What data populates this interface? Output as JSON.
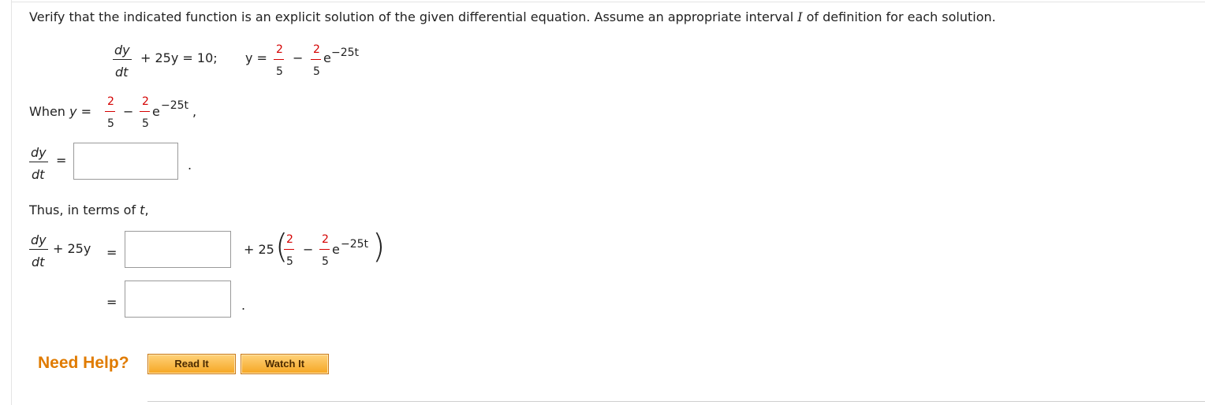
{
  "question": {
    "instructions_a": "Verify that the indicated function is an explicit solution of the given differential equation. Assume an appropriate interval ",
    "interval_symbol": "I",
    "instructions_b": " of definition for each solution."
  },
  "equation": {
    "dy": "dy",
    "dt": "dt",
    "plus_25y": "+ 25y = 10;",
    "y_eq": "y =",
    "two": "2",
    "five": "5",
    "minus": "−",
    "e": "e",
    "exponent": "−25t"
  },
  "when": {
    "prefix": "When ",
    "y": "y",
    "eq": " =",
    "comma": ","
  },
  "step1": {
    "dy": "dy",
    "dt": "dt",
    "equals": "=",
    "period": ".",
    "answer_value": ""
  },
  "thus": {
    "text_a": "Thus, in terms of ",
    "t": "t",
    "text_b": ","
  },
  "step2": {
    "dy": "dy",
    "dt": "dt",
    "plus_25y": "+ 25y",
    "equals": "=",
    "plus_25": "+ 25",
    "answer_value": ""
  },
  "step3": {
    "equals": "=",
    "period": ".",
    "answer_value": ""
  },
  "help": {
    "label": "Need Help?",
    "read_label": "Read It",
    "watch_label": "Watch It"
  }
}
